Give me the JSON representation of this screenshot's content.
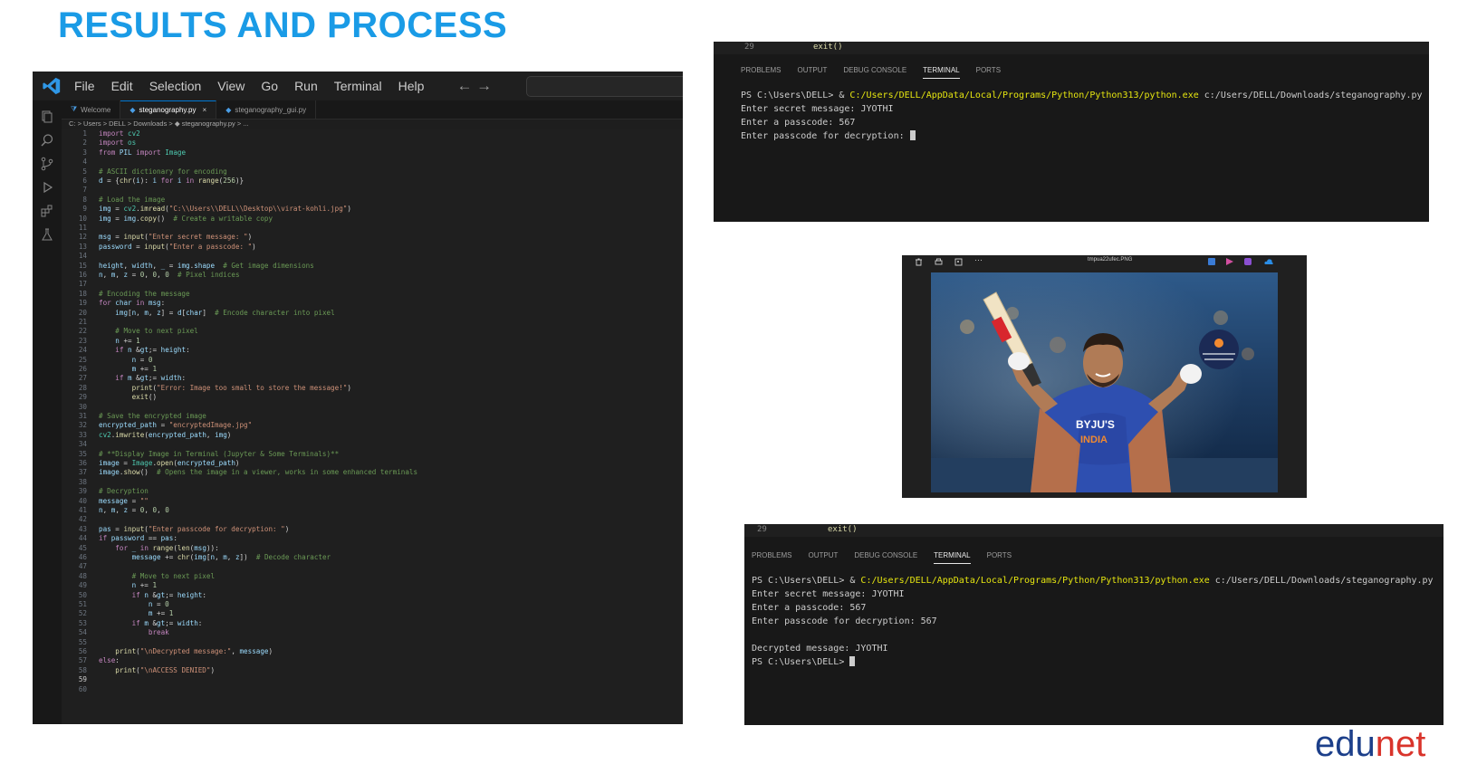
{
  "slide": {
    "title": "RESULTS AND PROCESS"
  },
  "vscode": {
    "menu": [
      "File",
      "Edit",
      "Selection",
      "View",
      "Go",
      "Run",
      "Terminal",
      "Help"
    ],
    "nav": "← →",
    "tabs": [
      {
        "label": "Welcome"
      },
      {
        "label": "steganography.py",
        "close": "×"
      },
      {
        "label": "steganography_gui.py"
      }
    ],
    "breadcrumb": "C: > Users > DELL > Downloads > ◆ steganography.py > ...",
    "code": [
      {
        "n": "1",
        "t": "import cv2"
      },
      {
        "n": "2",
        "t": "import os"
      },
      {
        "n": "3",
        "t": "from PIL import Image"
      },
      {
        "n": "4",
        "t": ""
      },
      {
        "n": "5",
        "t": "# ASCII dictionary for encoding"
      },
      {
        "n": "6",
        "t": "d = {chr(i): i for i in range(256)}"
      },
      {
        "n": "7",
        "t": ""
      },
      {
        "n": "8",
        "t": "# Load the image"
      },
      {
        "n": "9",
        "t": "img = cv2.imread(\"C:\\\\Users\\\\DELL\\\\Desktop\\\\virat-kohli.jpg\")"
      },
      {
        "n": "10",
        "t": "img = img.copy()  # Create a writable copy"
      },
      {
        "n": "11",
        "t": ""
      },
      {
        "n": "12",
        "t": "msg = input(\"Enter secret message: \")"
      },
      {
        "n": "13",
        "t": "password = input(\"Enter a passcode: \")"
      },
      {
        "n": "14",
        "t": ""
      },
      {
        "n": "15",
        "t": "height, width, _ = img.shape  # Get image dimensions"
      },
      {
        "n": "16",
        "t": "n, m, z = 0, 0, 0  # Pixel indices"
      },
      {
        "n": "17",
        "t": ""
      },
      {
        "n": "18",
        "t": "# Encoding the message"
      },
      {
        "n": "19",
        "t": "for char in msg:"
      },
      {
        "n": "20",
        "t": "    img[n, m, z] = d[char]  # Encode character into pixel"
      },
      {
        "n": "21",
        "t": ""
      },
      {
        "n": "22",
        "t": "    # Move to next pixel"
      },
      {
        "n": "23",
        "t": "    n += 1"
      },
      {
        "n": "24",
        "t": "    if n >= height:"
      },
      {
        "n": "25",
        "t": "        n = 0"
      },
      {
        "n": "26",
        "t": "        m += 1"
      },
      {
        "n": "27",
        "t": "    if m >= width:"
      },
      {
        "n": "28",
        "t": "        print(\"Error: Image too small to store the message!\")"
      },
      {
        "n": "29",
        "t": "        exit()"
      },
      {
        "n": "30",
        "t": ""
      },
      {
        "n": "31",
        "t": "# Save the encrypted image"
      },
      {
        "n": "32",
        "t": "encrypted_path = \"encryptedImage.jpg\""
      },
      {
        "n": "33",
        "t": "cv2.imwrite(encrypted_path, img)"
      },
      {
        "n": "34",
        "t": ""
      },
      {
        "n": "35",
        "t": "# **Display Image in Terminal (Jupyter & Some Terminals)**"
      },
      {
        "n": "36",
        "t": "image = Image.open(encrypted_path)"
      },
      {
        "n": "37",
        "t": "image.show()  # Opens the image in a viewer, works in some enhanced terminals"
      },
      {
        "n": "38",
        "t": ""
      },
      {
        "n": "39",
        "t": "# Decryption"
      },
      {
        "n": "40",
        "t": "message = \"\""
      },
      {
        "n": "41",
        "t": "n, m, z = 0, 0, 0"
      },
      {
        "n": "42",
        "t": ""
      },
      {
        "n": "43",
        "t": "pas = input(\"Enter passcode for decryption: \")"
      },
      {
        "n": "44",
        "t": "if password == pas:"
      },
      {
        "n": "45",
        "t": "    for _ in range(len(msg)):"
      },
      {
        "n": "46",
        "t": "        message += chr(img[n, m, z])  # Decode character"
      },
      {
        "n": "47",
        "t": ""
      },
      {
        "n": "48",
        "t": "        # Move to next pixel"
      },
      {
        "n": "49",
        "t": "        n += 1"
      },
      {
        "n": "50",
        "t": "        if n >= height:"
      },
      {
        "n": "51",
        "t": "            n = 0"
      },
      {
        "n": "52",
        "t": "            m += 1"
      },
      {
        "n": "53",
        "t": "        if m >= width:"
      },
      {
        "n": "54",
        "t": "            break"
      },
      {
        "n": "55",
        "t": ""
      },
      {
        "n": "56",
        "t": "    print(\"\\nDecrypted message:\", message)"
      },
      {
        "n": "57",
        "t": "else:"
      },
      {
        "n": "58",
        "t": "    print(\"\\nACCESS DENIED\")"
      },
      {
        "n": "59",
        "t": ""
      },
      {
        "n": "60",
        "t": ""
      }
    ],
    "current_line": "59"
  },
  "terminal_top": {
    "line_number": "29",
    "line_code": "exit()",
    "tabs": [
      "PROBLEMS",
      "OUTPUT",
      "DEBUG CONSOLE",
      "TERMINAL",
      "PORTS"
    ],
    "active_tab": "TERMINAL",
    "prompt": "PS C:\\Users\\DELL> & ",
    "command_path": "C:/Users/DELL/AppData/Local/Programs/Python/Python313/python.exe",
    "command_arg": " c:/Users/DELL/Downloads/steganography.py",
    "lines": [
      "Enter secret message: JYOTHI",
      "Enter a passcode: 567",
      "Enter passcode for decryption: "
    ]
  },
  "viewer": {
    "filename": "tmpua22ufec.PNG"
  },
  "terminal_bottom": {
    "line_number": "29",
    "line_code": "exit()",
    "tabs": [
      "PROBLEMS",
      "OUTPUT",
      "DEBUG CONSOLE",
      "TERMINAL",
      "PORTS"
    ],
    "active_tab": "TERMINAL",
    "prompt": "PS C:\\Users\\DELL> & ",
    "command_path": "C:/Users/DELL/AppData/Local/Programs/Python/Python313/python.exe",
    "command_arg": " c:/Users/DELL/Downloads/steganography.py",
    "lines": [
      "Enter secret message: JYOTHI",
      "Enter a passcode: 567",
      "Enter passcode for decryption: 567",
      "",
      "Decrypted message: JYOTHI"
    ],
    "final_prompt": "PS C:\\Users\\DELL> "
  },
  "logo": {
    "edu": "edu",
    "net": "net"
  },
  "colors": {
    "title": "#1a9be6",
    "vscode_accent": "#0078d4",
    "path_yellow": "#e5e510"
  }
}
